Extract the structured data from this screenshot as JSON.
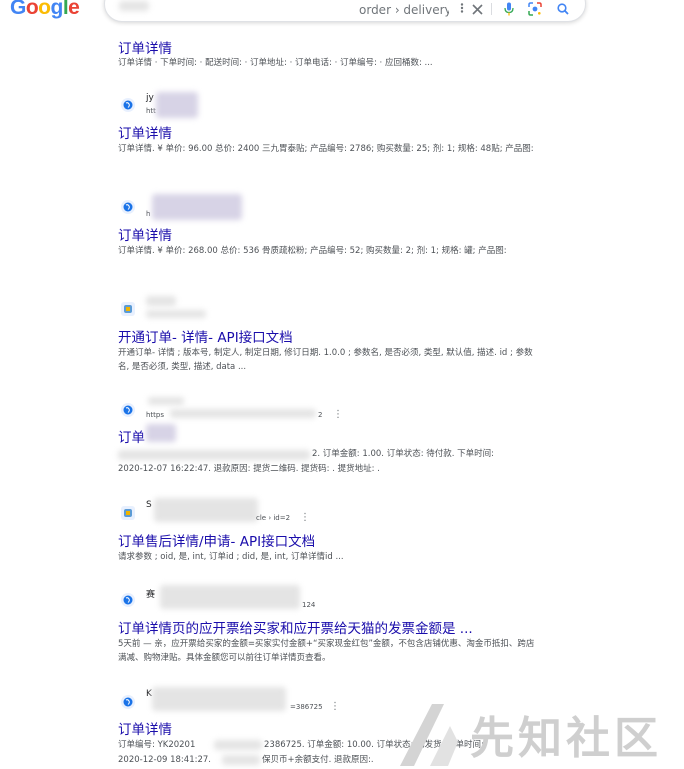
{
  "header": {
    "logo_letters": [
      "G",
      "o",
      "o",
      "g",
      "l",
      "e"
    ],
    "search_value": "order › delivery...",
    "icons": [
      "close-icon",
      "microphone-icon",
      "lens-icon",
      "search-icon"
    ]
  },
  "results": [
    {
      "url": "order › deliveryn...",
      "title": "订单详情",
      "snippet": "订单详情 · 下单时间: · 配送时间: · 订单地址: · 订单电话: · 订单编号: · 应回桶数: ..."
    },
    {
      "site": "jy",
      "url": "htt",
      "title": "订单详情",
      "snippet": "订单详情. ¥ 单价: 96.00 总价: 2400 三九胃泰贴; 产品编号: 2786; 购买数量: 25; 剂: 1; 规格: 48贴; 产品图:"
    },
    {
      "url": "h",
      "title": "订单详情",
      "snippet": "订单详情. ¥ 单价: 268.00 总价: 536 骨质疏松粉; 产品编号: 52; 购买数量: 2; 剂: 1; 规格: 罐; 产品图:"
    },
    {
      "title": "开通订单- 详情- API接口文档",
      "snippet": "开通订单- 详情 ; 版本号, 制定人, 制定日期, 修订日期. 1.0.0 ; 参数名, 是否必须, 类型, 默认值, 描述. id ; 参数名, 是否必须, 类型, 描述, data ..."
    },
    {
      "url_start": "https",
      "url_end": "2",
      "title": "订单",
      "snippet_tail": "2. 订单金额: 1.00. 订单状态: 待付款. 下单时间:",
      "snippet_line2": "2020-12-07 16:22:47. 退款原因: 提货二维码. 提货码: . 提货地址: ."
    },
    {
      "site": "S",
      "url_end": "cle › id=2",
      "title": "订单售后详情/申请- API接口文档",
      "snippet": "请求参数 ; oid, 是, int, 订单id ; did, 是, int, 订单详情id ..."
    },
    {
      "site": "赛",
      "url_end": "124",
      "title": "订单详情页的应开票给买家和应开票给天猫的发票金额是 ...",
      "snippet": "5天前 — 亲，应开票给买家的金额=买家实付金额+“买家现金红包”金额，不包含店铺优惠、淘金币抵扣、跨店满减、购物津贴。具体金额您可以前往订单详情页查看。"
    },
    {
      "site": "K",
      "url_end": "=386725",
      "title": "订单详情",
      "snippet_start": "订单编号: YK20201",
      "snippet_mid": "2386725. 订单金额: 10.00. 订单状态: 已发货. 下单时间:",
      "snippet_line2_start": "2020-12-09 18:41:27.",
      "snippet_line2_end": "保贝币+余额支付. 退款原因:."
    }
  ],
  "watermark": {
    "text": "先知社区"
  }
}
